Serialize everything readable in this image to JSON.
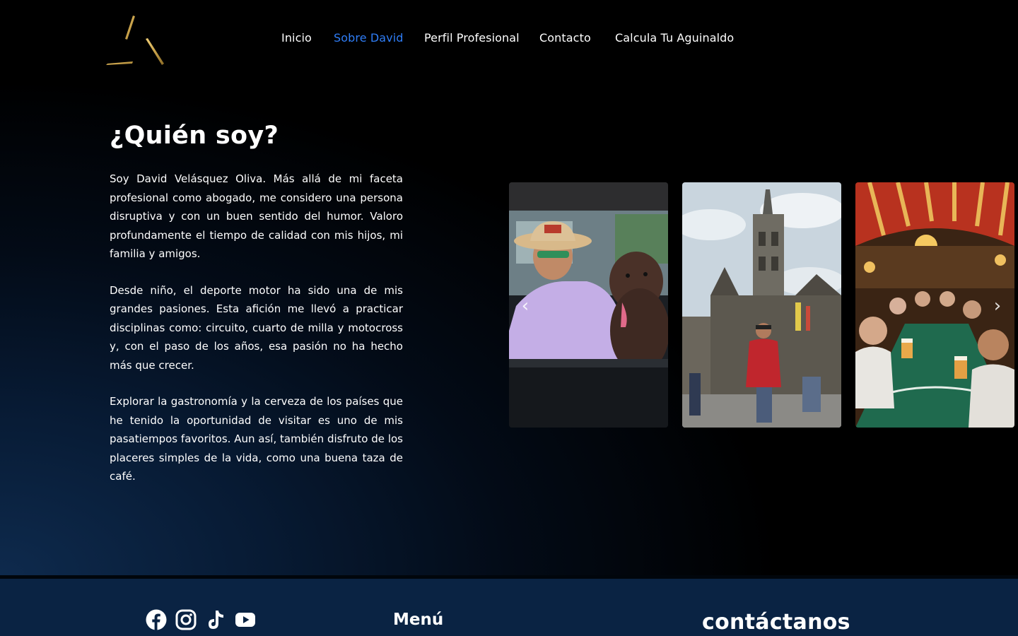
{
  "nav": {
    "items": [
      {
        "label": "Inicio"
      },
      {
        "label": "Sobre David"
      },
      {
        "label": "Perfil Profesional"
      },
      {
        "label": "Contacto"
      },
      {
        "label": "Calcula Tu Aguinaldo"
      }
    ],
    "active_index": 1
  },
  "about": {
    "title": "¿Quién soy?",
    "paragraphs": [
      "Soy David Velásquez Oliva. Más allá de mi faceta profesional como abogado, me considero una persona disruptiva y con un buen sentido del humor. Valoro profundamente el tiempo de calidad con mis hijos, mi familia y amigos.",
      "Desde niño, el deporte motor ha sido una de mis grandes pasiones. Esta afición me llevó a practicar disciplinas como: circuito, cuarto de milla y motocross y, con el paso de los años, esa pasión no ha hecho más que crecer.",
      "Explorar la gastronomía y la cerveza de los países que he tenido la oportunidad de visitar es uno de mis pasatiempos favoritos. Aun así, también disfruto de los placeres simples de la vida, como una buena taza de café."
    ]
  },
  "carousel": {
    "prev_icon": "chevron-left-icon",
    "next_icon": "chevron-right-icon",
    "prev_glyph": "‹",
    "next_glyph": "›"
  },
  "footer": {
    "social": [
      "facebook-icon",
      "instagram-icon",
      "tiktok-icon",
      "youtube-icon"
    ],
    "menu_heading": "Menú",
    "contact_heading": "contáctanos"
  },
  "colors": {
    "accent": "#2f7df6",
    "footer_bg": "#0a2343",
    "logo_gold": "#c9a24a"
  }
}
